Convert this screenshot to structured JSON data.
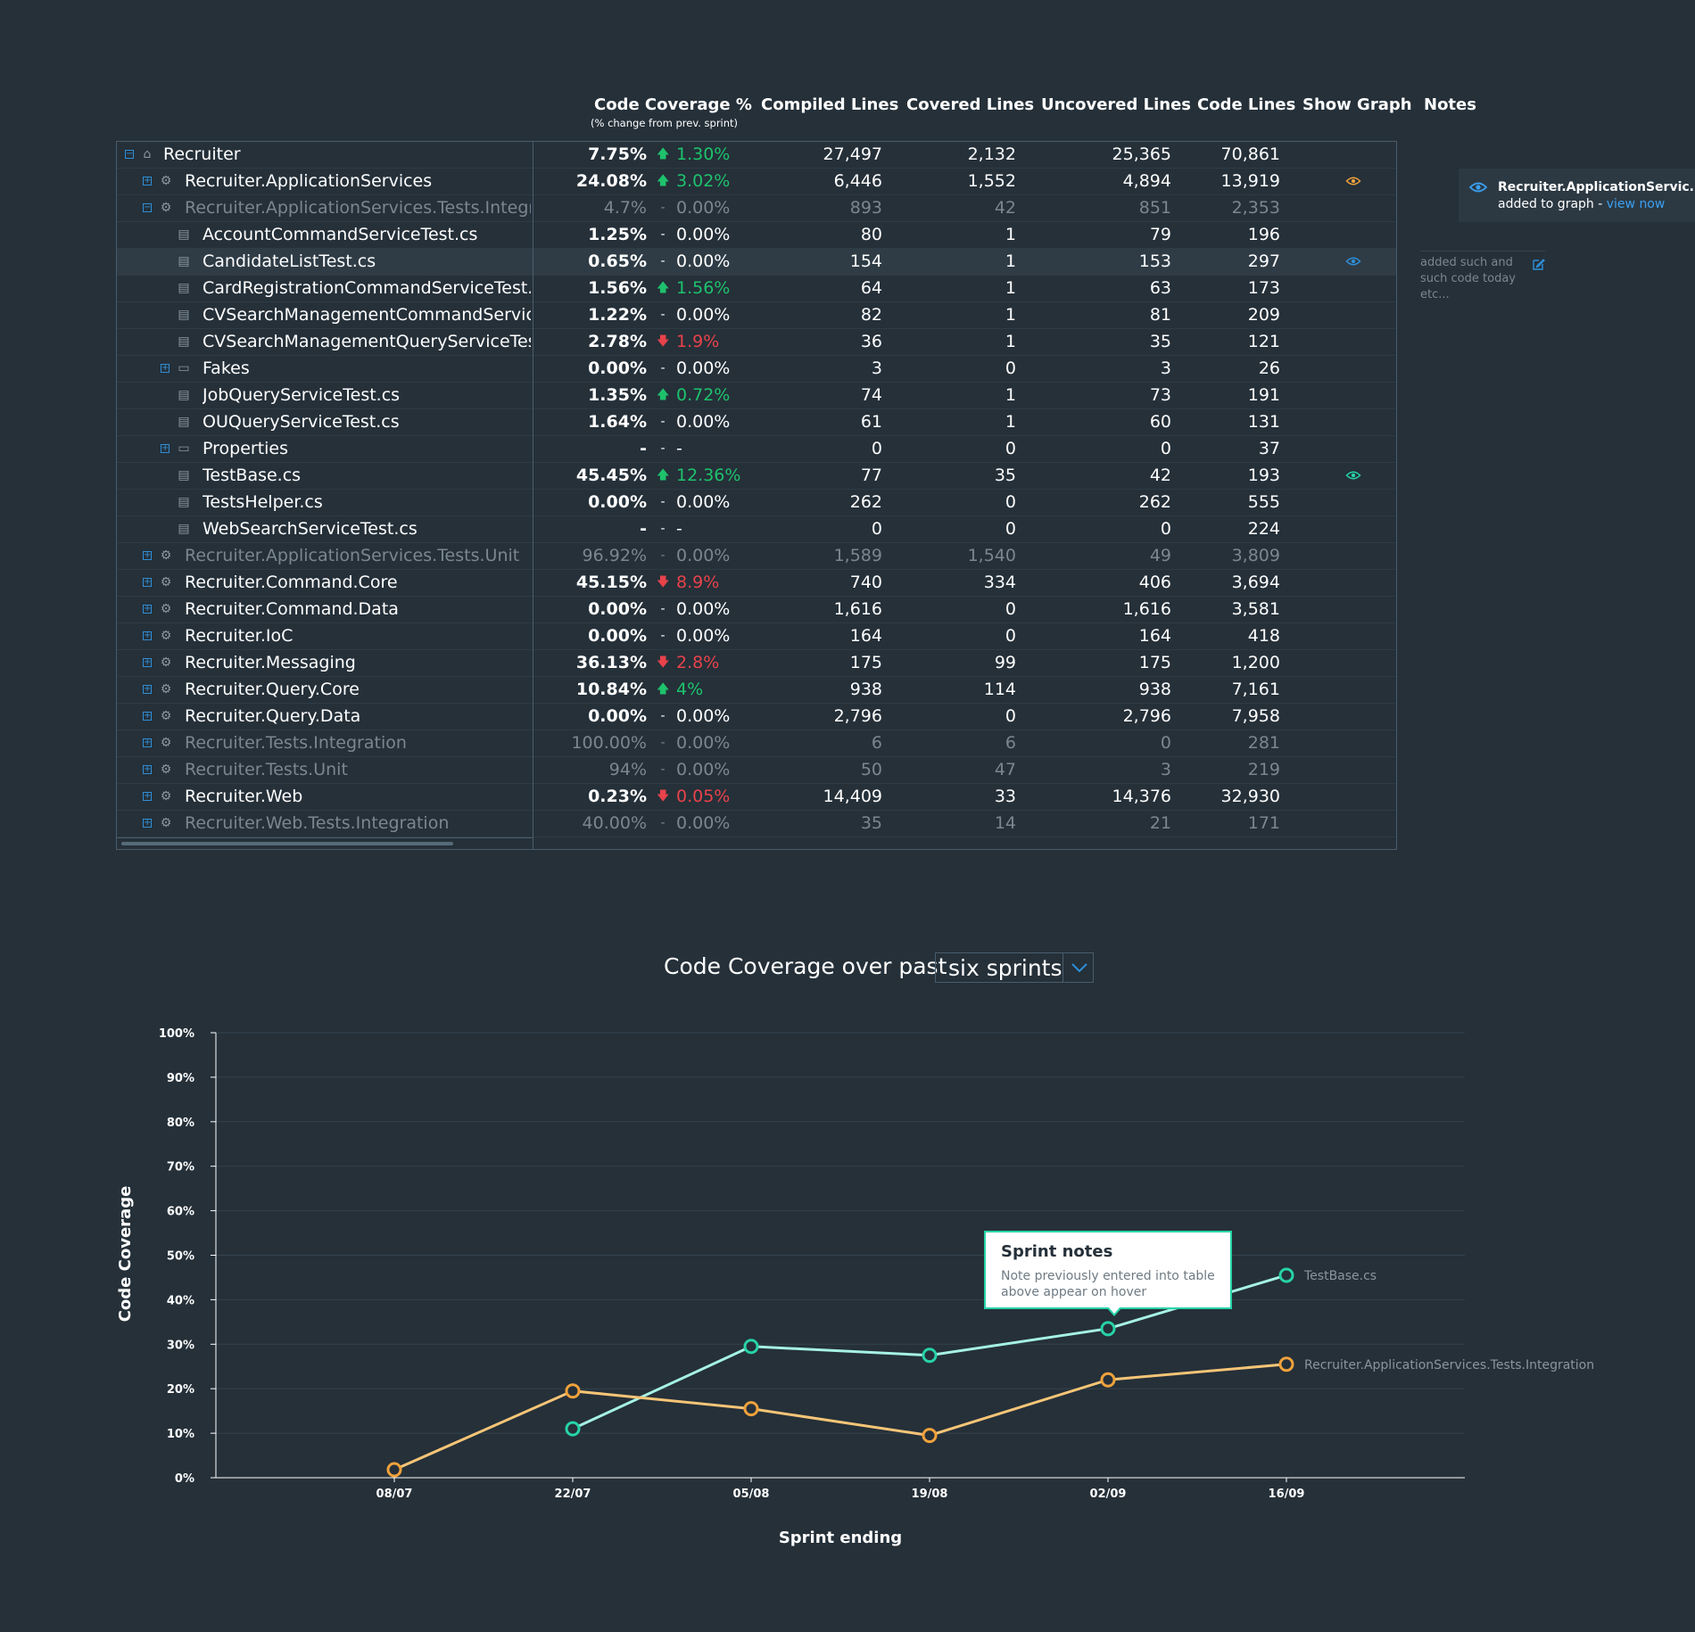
{
  "table": {
    "headers": {
      "coverage": "Code Coverage %",
      "coverage_sub": "(% change from prev. sprint)",
      "compiled": "Compiled Lines",
      "covered": "Covered Lines",
      "uncovered": "Uncovered Lines",
      "code": "Code Lines",
      "graph": "Show Graph",
      "notes": "Notes"
    },
    "rows": [
      {
        "name": "Recruiter",
        "level": 0,
        "kind": "home",
        "expander": "minus",
        "dim": false,
        "pct": "7.75%",
        "dir": "up",
        "chg": "1.30%",
        "compiled": "27,497",
        "covered": "2,132",
        "uncovered": "25,365",
        "code": "70,861",
        "eye": null
      },
      {
        "name": "Recruiter.ApplicationServices",
        "level": 1,
        "kind": "project",
        "expander": "plus",
        "dim": false,
        "pct": "24.08%",
        "dir": "up",
        "chg": "3.02%",
        "compiled": "6,446",
        "covered": "1,552",
        "uncovered": "4,894",
        "code": "13,919",
        "eye": "orange"
      },
      {
        "name": "Recruiter.ApplicationServices.Tests.Integration",
        "level": 1,
        "kind": "project",
        "expander": "minus",
        "dim": true,
        "pct": "4.7%",
        "dir": "none",
        "chg": "0.00%",
        "compiled": "893",
        "covered": "42",
        "uncovered": "851",
        "code": "2,353",
        "eye": null
      },
      {
        "name": "AccountCommandServiceTest.cs",
        "level": 2,
        "kind": "file",
        "expander": null,
        "dim": false,
        "pct": "1.25%",
        "dir": "none",
        "chg": "0.00%",
        "compiled": "80",
        "covered": "1",
        "uncovered": "79",
        "code": "196",
        "eye": null
      },
      {
        "name": "CandidateListTest.cs",
        "level": 2,
        "kind": "file",
        "expander": null,
        "dim": false,
        "selected": true,
        "pct": "0.65%",
        "dir": "none",
        "chg": "0.00%",
        "compiled": "154",
        "covered": "1",
        "uncovered": "153",
        "code": "297",
        "eye": "blue"
      },
      {
        "name": "CardRegistrationCommandServiceTest.cs",
        "level": 2,
        "kind": "file",
        "expander": null,
        "dim": false,
        "pct": "1.56%",
        "dir": "up",
        "chg": "1.56%",
        "compiled": "64",
        "covered": "1",
        "uncovered": "63",
        "code": "173",
        "eye": null
      },
      {
        "name": "CVSearchManagementCommandServiceTes",
        "level": 2,
        "kind": "file",
        "expander": null,
        "dim": false,
        "pct": "1.22%",
        "dir": "none",
        "chg": "0.00%",
        "compiled": "82",
        "covered": "1",
        "uncovered": "81",
        "code": "209",
        "eye": null
      },
      {
        "name": "CVSearchManagementQueryServiceTest.cs",
        "level": 2,
        "kind": "file",
        "expander": null,
        "dim": false,
        "pct": "2.78%",
        "dir": "down",
        "chg": "1.9%",
        "compiled": "36",
        "covered": "1",
        "uncovered": "35",
        "code": "121",
        "eye": null
      },
      {
        "name": "Fakes",
        "level": 2,
        "kind": "folder",
        "expander": "plus",
        "dim": false,
        "pct": "0.00%",
        "dir": "none",
        "chg": "0.00%",
        "compiled": "3",
        "covered": "0",
        "uncovered": "3",
        "code": "26",
        "eye": null
      },
      {
        "name": "JobQueryServiceTest.cs",
        "level": 2,
        "kind": "file",
        "expander": null,
        "dim": false,
        "pct": "1.35%",
        "dir": "up",
        "chg": "0.72%",
        "compiled": "74",
        "covered": "1",
        "uncovered": "73",
        "code": "191",
        "eye": null
      },
      {
        "name": "OUQueryServiceTest.cs",
        "level": 2,
        "kind": "file",
        "expander": null,
        "dim": false,
        "pct": "1.64%",
        "dir": "none",
        "chg": "0.00%",
        "compiled": "61",
        "covered": "1",
        "uncovered": "60",
        "code": "131",
        "eye": null
      },
      {
        "name": "Properties",
        "level": 2,
        "kind": "folder",
        "expander": "plus",
        "dim": false,
        "pct": "-",
        "dir": "none",
        "chg": "-",
        "compiled": "0",
        "covered": "0",
        "uncovered": "0",
        "code": "37",
        "eye": null
      },
      {
        "name": "TestBase.cs",
        "level": 2,
        "kind": "file",
        "expander": null,
        "dim": false,
        "pct": "45.45%",
        "dir": "up",
        "chg": "12.36%",
        "compiled": "77",
        "covered": "35",
        "uncovered": "42",
        "code": "193",
        "eye": "teal"
      },
      {
        "name": "TestsHelper.cs",
        "level": 2,
        "kind": "file",
        "expander": null,
        "dim": false,
        "pct": "0.00%",
        "dir": "none",
        "chg": "0.00%",
        "compiled": "262",
        "covered": "0",
        "uncovered": "262",
        "code": "555",
        "eye": null
      },
      {
        "name": "WebSearchServiceTest.cs",
        "level": 2,
        "kind": "file",
        "expander": null,
        "dim": false,
        "pct": "-",
        "dir": "none",
        "chg": "-",
        "compiled": "0",
        "covered": "0",
        "uncovered": "0",
        "code": "224",
        "eye": null
      },
      {
        "name": "Recruiter.ApplicationServices.Tests.Unit",
        "level": 1,
        "kind": "project",
        "expander": "plus",
        "dim": true,
        "pct": "96.92%",
        "dir": "none",
        "chg": "0.00%",
        "compiled": "1,589",
        "covered": "1,540",
        "uncovered": "49",
        "code": "3,809",
        "eye": null
      },
      {
        "name": "Recruiter.Command.Core",
        "level": 1,
        "kind": "project",
        "expander": "plus",
        "dim": false,
        "pct": "45.15%",
        "dir": "down",
        "chg": "8.9%",
        "compiled": "740",
        "covered": "334",
        "uncovered": "406",
        "code": "3,694",
        "eye": null
      },
      {
        "name": "Recruiter.Command.Data",
        "level": 1,
        "kind": "project",
        "expander": "plus",
        "dim": false,
        "pct": "0.00%",
        "dir": "none",
        "chg": "0.00%",
        "compiled": "1,616",
        "covered": "0",
        "uncovered": "1,616",
        "code": "3,581",
        "eye": null
      },
      {
        "name": "Recruiter.IoC",
        "level": 1,
        "kind": "project",
        "expander": "plus",
        "dim": false,
        "pct": "0.00%",
        "dir": "none",
        "chg": "0.00%",
        "compiled": "164",
        "covered": "0",
        "uncovered": "164",
        "code": "418",
        "eye": null
      },
      {
        "name": "Recruiter.Messaging",
        "level": 1,
        "kind": "project",
        "expander": "plus",
        "dim": false,
        "pct": "36.13%",
        "dir": "down",
        "chg": "2.8%",
        "compiled": "175",
        "covered": "99",
        "uncovered": "175",
        "code": "1,200",
        "eye": null
      },
      {
        "name": "Recruiter.Query.Core",
        "level": 1,
        "kind": "project",
        "expander": "plus",
        "dim": false,
        "pct": "10.84%",
        "dir": "up",
        "chg": "4%",
        "compiled": "938",
        "covered": "114",
        "uncovered": "938",
        "code": "7,161",
        "eye": null
      },
      {
        "name": "Recruiter.Query.Data",
        "level": 1,
        "kind": "project",
        "expander": "plus",
        "dim": false,
        "pct": "0.00%",
        "dir": "none",
        "chg": "0.00%",
        "compiled": "2,796",
        "covered": "0",
        "uncovered": "2,796",
        "code": "7,958",
        "eye": null
      },
      {
        "name": "Recruiter.Tests.Integration",
        "level": 1,
        "kind": "project",
        "expander": "plus",
        "dim": true,
        "pct": "100.00%",
        "dir": "none",
        "chg": "0.00%",
        "compiled": "6",
        "covered": "6",
        "uncovered": "0",
        "code": "281",
        "eye": null
      },
      {
        "name": "Recruiter.Tests.Unit",
        "level": 1,
        "kind": "project",
        "expander": "plus",
        "dim": true,
        "pct": "94%",
        "dir": "none",
        "chg": "0.00%",
        "compiled": "50",
        "covered": "47",
        "uncovered": "3",
        "code": "219",
        "eye": null
      },
      {
        "name": "Recruiter.Web",
        "level": 1,
        "kind": "project",
        "expander": "plus",
        "dim": false,
        "pct": "0.23%",
        "dir": "down",
        "chg": "0.05%",
        "compiled": "14,409",
        "covered": "33",
        "uncovered": "14,376",
        "code": "32,930",
        "eye": null
      },
      {
        "name": "Recruiter.Web.Tests.Integration",
        "level": 1,
        "kind": "project",
        "expander": "plus",
        "dim": true,
        "pct": "40.00%",
        "dir": "none",
        "chg": "0.00%",
        "compiled": "35",
        "covered": "14",
        "uncovered": "21",
        "code": "171",
        "eye": null
      }
    ]
  },
  "graph_panel": {
    "title": "Recruiter.ApplicationServic...",
    "added_text": "added to graph - ",
    "link": "view now"
  },
  "note": {
    "text": "added such and such code today etc..."
  },
  "chart_header": {
    "title": "Code Coverage over past",
    "select_value": "six sprints"
  },
  "tooltip": {
    "title": "Sprint notes",
    "body": "Note previously entered into table above appear on hover"
  },
  "colors": {
    "teal": "#27d3a8",
    "orange": "#f0a23c",
    "blue": "#2f8fd8",
    "up": "#1ec26c",
    "down": "#e8424a"
  },
  "chart_data": {
    "type": "line",
    "xlabel": "Sprint ending",
    "ylabel": "Code Coverage",
    "categories": [
      "08/07",
      "22/07",
      "05/08",
      "19/08",
      "02/09",
      "16/09"
    ],
    "ylim": [
      0,
      100
    ],
    "yticks": [
      "0%",
      "10%",
      "20%",
      "30%",
      "40%",
      "50%",
      "60%",
      "70%",
      "80%",
      "90%",
      "100%"
    ],
    "grid": true,
    "series": [
      {
        "name": "TestBase.cs",
        "color": "#27d3a8",
        "values": [
          null,
          11,
          29.5,
          27.5,
          33.5,
          45.5
        ]
      },
      {
        "name": "Recruiter.ApplicationServices.Tests.Integration",
        "color": "#f0a23c",
        "values": [
          1.8,
          19.5,
          15.5,
          9.5,
          22,
          25.5
        ]
      }
    ]
  }
}
